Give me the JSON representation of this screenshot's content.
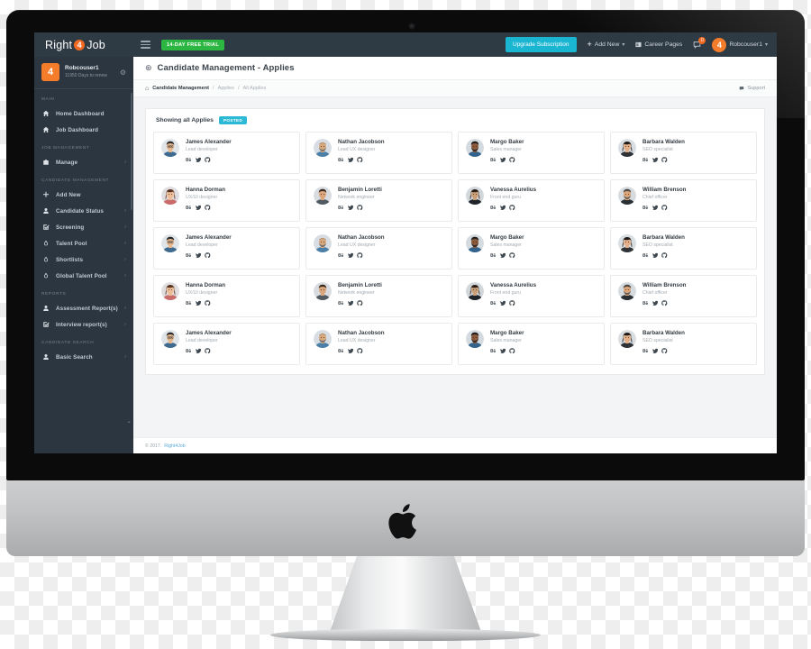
{
  "topbar": {
    "brand_left": "Right",
    "brand_mark": "4",
    "brand_right": "Job",
    "menu_icon": "hamburger-icon",
    "trial_badge": "14-DAY FREE TRIAL",
    "upgrade_label": "Upgrade Subscription",
    "add_new_label": "Add New",
    "career_pages_label": "Career Pages",
    "chat_badge": "0",
    "user_name": "Robcouser1",
    "avatar_letter": "4",
    "accent_green": "#2cb742",
    "accent_cyan": "#19b5d1",
    "accent_orange": "#f26a21",
    "bar_bg": "#2e3a44"
  },
  "sidebar": {
    "profile": {
      "name": "Robcouser1",
      "subtitle": "11950 Days to renew",
      "avatar_letter": "4"
    },
    "sections": [
      {
        "title": "MAIN",
        "items": [
          {
            "label": "Home Dashboard",
            "icon": "home-icon",
            "arrow": false
          },
          {
            "label": "Job Dashboard",
            "icon": "home-icon",
            "arrow": false
          }
        ]
      },
      {
        "title": "JOB MANAGEMENT",
        "items": [
          {
            "label": "Manage",
            "icon": "briefcase-icon",
            "arrow": true
          }
        ]
      },
      {
        "title": "CANDIDATE MANAGEMENT",
        "items": [
          {
            "label": "Add New",
            "icon": "plus-icon",
            "arrow": false
          },
          {
            "label": "Candidate Status",
            "icon": "user-icon",
            "arrow": true
          },
          {
            "label": "Screening",
            "icon": "check-square-icon",
            "arrow": true
          },
          {
            "label": "Talent Pool",
            "icon": "drop-icon",
            "arrow": true
          },
          {
            "label": "Shortlists",
            "icon": "drop-icon",
            "arrow": true
          },
          {
            "label": "Global Talent Pool",
            "icon": "drop-icon",
            "arrow": true
          }
        ]
      },
      {
        "title": "REPORTS",
        "items": [
          {
            "label": "Assessment Report(s)",
            "icon": "user-icon",
            "arrow": true
          },
          {
            "label": "Interview report(s)",
            "icon": "check-square-icon",
            "arrow": true
          }
        ]
      },
      {
        "title": "CANDIDATE SEARCH",
        "items": [
          {
            "label": "Basic Search",
            "icon": "user-icon",
            "arrow": true
          }
        ]
      }
    ]
  },
  "page": {
    "title": "Candidate Management - Applies",
    "title_icon": "gear-circle-icon",
    "breadcrumb": {
      "home_icon": "home-icon",
      "root": "Candidate Management",
      "sep": "/",
      "level2": "Applies",
      "level3": "All Applies",
      "support_label": "Support",
      "support_icon": "chat-icon"
    }
  },
  "panel": {
    "heading": "Showing all Applies",
    "badge": "POSTED"
  },
  "candidates": [
    {
      "name": "James Alexander",
      "role": "Lead developer",
      "socials": [
        "behance-icon",
        "twitter-icon",
        "github-icon"
      ]
    },
    {
      "name": "Nathan Jacobson",
      "role": "Lead UX designer",
      "socials": [
        "behance-icon",
        "twitter-icon",
        "github-icon"
      ]
    },
    {
      "name": "Margo Baker",
      "role": "Sales manager",
      "socials": [
        "behance-icon",
        "twitter-icon",
        "github-icon"
      ]
    },
    {
      "name": "Barbara Walden",
      "role": "SEO specialist",
      "socials": [
        "behance-icon",
        "twitter-icon",
        "github-icon"
      ]
    },
    {
      "name": "Hanna Dorman",
      "role": "UX/UI designer",
      "socials": [
        "behance-icon",
        "twitter-icon",
        "github-icon"
      ]
    },
    {
      "name": "Benjamin Loretti",
      "role": "Network engineer",
      "socials": [
        "behance-icon",
        "twitter-icon",
        "github-icon"
      ]
    },
    {
      "name": "Vanessa Aurelius",
      "role": "Front end guru",
      "socials": [
        "behance-icon",
        "twitter-icon",
        "github-icon"
      ]
    },
    {
      "name": "William Brenson",
      "role": "Chief officer",
      "socials": [
        "behance-icon",
        "twitter-icon",
        "github-icon"
      ]
    },
    {
      "name": "James Alexander",
      "role": "Lead developer",
      "socials": [
        "behance-icon",
        "twitter-icon",
        "github-icon"
      ]
    },
    {
      "name": "Nathan Jacobson",
      "role": "Lead UX designer",
      "socials": [
        "behance-icon",
        "twitter-icon",
        "github-icon"
      ]
    },
    {
      "name": "Margo Baker",
      "role": "Sales manager",
      "socials": [
        "behance-icon",
        "twitter-icon",
        "github-icon"
      ]
    },
    {
      "name": "Barbara Walden",
      "role": "SEO specialist",
      "socials": [
        "behance-icon",
        "twitter-icon",
        "github-icon"
      ]
    },
    {
      "name": "Hanna Dorman",
      "role": "UX/UI designer",
      "socials": [
        "behance-icon",
        "twitter-icon",
        "github-icon"
      ]
    },
    {
      "name": "Benjamin Loretti",
      "role": "Network engineer",
      "socials": [
        "behance-icon",
        "twitter-icon",
        "github-icon"
      ]
    },
    {
      "name": "Vanessa Aurelius",
      "role": "Front end guru",
      "socials": [
        "behance-icon",
        "twitter-icon",
        "github-icon"
      ]
    },
    {
      "name": "William Brenson",
      "role": "Chief officer",
      "socials": [
        "behance-icon",
        "twitter-icon",
        "github-icon"
      ]
    },
    {
      "name": "James Alexander",
      "role": "Lead developer",
      "socials": [
        "behance-icon",
        "twitter-icon",
        "github-icon"
      ]
    },
    {
      "name": "Nathan Jacobson",
      "role": "Lead UX designer",
      "socials": [
        "behance-icon",
        "twitter-icon",
        "github-icon"
      ]
    },
    {
      "name": "Margo Baker",
      "role": "Sales manager",
      "socials": [
        "behance-icon",
        "twitter-icon",
        "github-icon"
      ]
    },
    {
      "name": "Barbara Walden",
      "role": "SEO specialist",
      "socials": [
        "behance-icon",
        "twitter-icon",
        "github-icon"
      ]
    }
  ],
  "footer": {
    "copyright": "© 2017.",
    "link": "Right4Job"
  },
  "device": {
    "logo": "apple-logo"
  }
}
